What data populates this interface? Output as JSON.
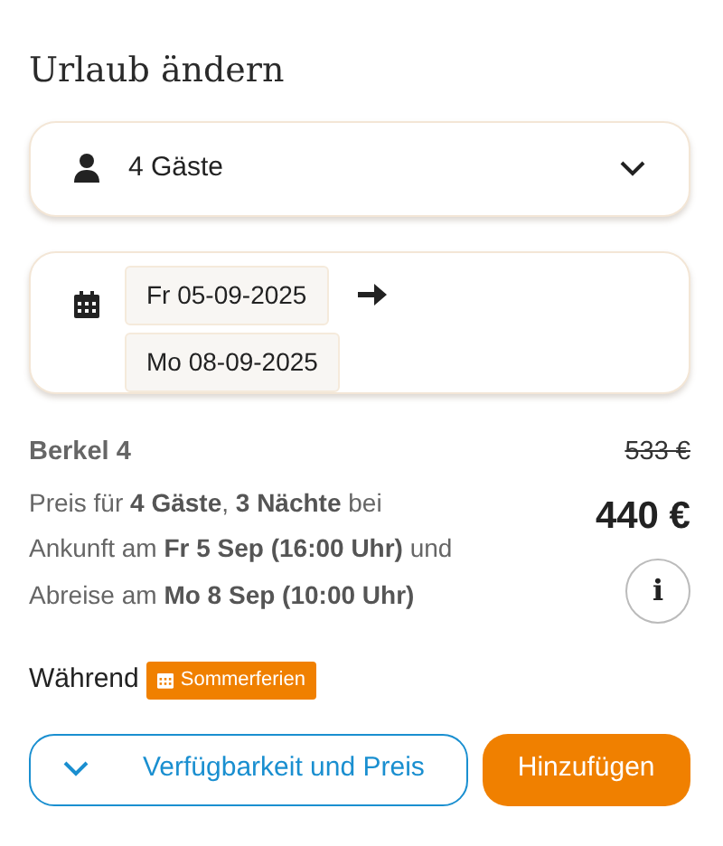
{
  "heading": "Urlaub ändern",
  "guests": {
    "label": "4 Gäste"
  },
  "dates": {
    "arrival": "Fr 05-09-2025",
    "departure": "Mo 08-09-2025"
  },
  "offer": {
    "name": "Berkel 4",
    "description_lines": [
      "Preis für **4 Gäste**, **3 Nächte** bei",
      "Ankunft am **Fr 5 Sep (16:00 Uhr)** und",
      "Abreise am **Mo 8 Sep (10:00 Uhr)**"
    ],
    "old_price": "533 €",
    "price": "440 €",
    "info_button": "i"
  },
  "period": {
    "label": "Während",
    "tag": "Sommerferien"
  },
  "buttons": [
    {
      "label": "Verfügbarkeit und Preis",
      "kind": "outline"
    },
    {
      "label": "Hinzufügen",
      "kind": "primary"
    }
  ]
}
